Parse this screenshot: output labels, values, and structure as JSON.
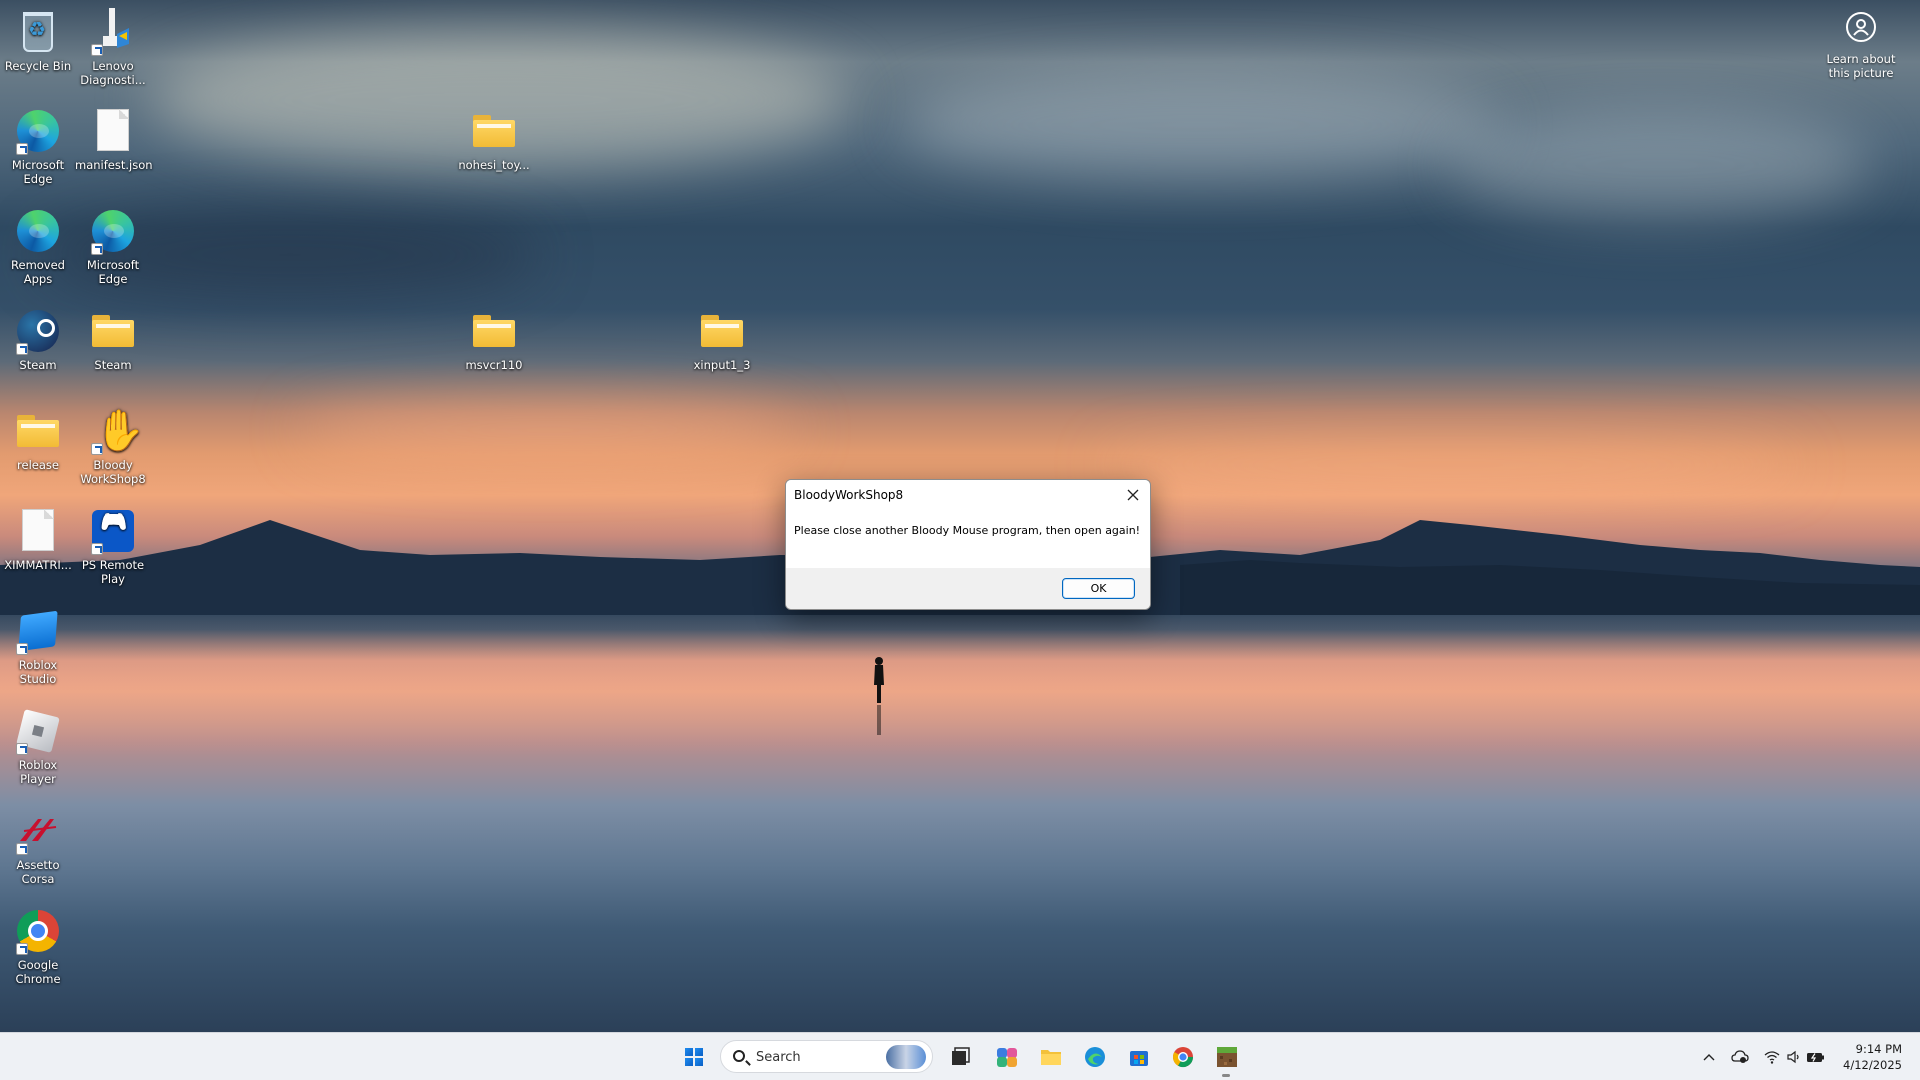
{
  "desktop": {
    "icons": [
      {
        "key": "recycle-bin",
        "label": "Recycle Bin"
      },
      {
        "key": "lenovo-diagnostics",
        "label": "Lenovo Diagnosti..."
      },
      {
        "key": "microsoft-edge-1",
        "label": "Microsoft Edge"
      },
      {
        "key": "manifest-json",
        "label": "manifest.json"
      },
      {
        "key": "nohesi-toy",
        "label": "nohesi_toy..."
      },
      {
        "key": "removed-apps",
        "label": "Removed Apps"
      },
      {
        "key": "microsoft-edge-2",
        "label": "Microsoft Edge"
      },
      {
        "key": "steam-app",
        "label": "Steam"
      },
      {
        "key": "steam-folder",
        "label": "Steam"
      },
      {
        "key": "msvcr110",
        "label": "msvcr110"
      },
      {
        "key": "xinput1-3",
        "label": "xinput1_3"
      },
      {
        "key": "release",
        "label": "release"
      },
      {
        "key": "bloody-workshop8",
        "label": "Bloody WorkShop8"
      },
      {
        "key": "ximmatri",
        "label": "XIMMATRI..."
      },
      {
        "key": "ps-remote-play",
        "label": "PS Remote Play"
      },
      {
        "key": "roblox-studio",
        "label": "Roblox Studio"
      },
      {
        "key": "roblox-player",
        "label": "Roblox Player"
      },
      {
        "key": "assetto-corsa",
        "label": "Assetto Corsa"
      },
      {
        "key": "google-chrome",
        "label": "Google Chrome"
      }
    ],
    "learn_about": "Learn about this picture"
  },
  "dialog": {
    "title": "BloodyWorkShop8",
    "message": "Please close another Bloody Mouse program, then open again!",
    "ok_label": "OK"
  },
  "taskbar": {
    "search_placeholder": "Search",
    "pinned": [
      "start-icon",
      "task-view-icon",
      "copilot-icon",
      "file-explorer-icon",
      "edge-icon",
      "store-icon",
      "chrome-icon",
      "minecraft-icon"
    ],
    "time": "9:14 PM",
    "date": "4/12/2025"
  },
  "colors": {
    "accent": "#0067c0",
    "taskbar_bg": "#eef1f5",
    "dialog_bg": "#f0f0f0"
  }
}
